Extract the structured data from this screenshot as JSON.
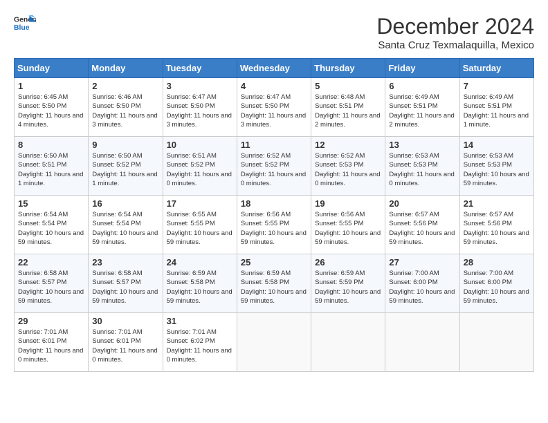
{
  "header": {
    "logo_line1": "General",
    "logo_line2": "Blue",
    "month": "December 2024",
    "location": "Santa Cruz Texmalaquilla, Mexico"
  },
  "days_of_week": [
    "Sunday",
    "Monday",
    "Tuesday",
    "Wednesday",
    "Thursday",
    "Friday",
    "Saturday"
  ],
  "weeks": [
    [
      {
        "day": 1,
        "sunrise": "6:45 AM",
        "sunset": "5:50 PM",
        "daylight": "11 hours and 4 minutes."
      },
      {
        "day": 2,
        "sunrise": "6:46 AM",
        "sunset": "5:50 PM",
        "daylight": "11 hours and 3 minutes."
      },
      {
        "day": 3,
        "sunrise": "6:47 AM",
        "sunset": "5:50 PM",
        "daylight": "11 hours and 3 minutes."
      },
      {
        "day": 4,
        "sunrise": "6:47 AM",
        "sunset": "5:50 PM",
        "daylight": "11 hours and 3 minutes."
      },
      {
        "day": 5,
        "sunrise": "6:48 AM",
        "sunset": "5:51 PM",
        "daylight": "11 hours and 2 minutes."
      },
      {
        "day": 6,
        "sunrise": "6:49 AM",
        "sunset": "5:51 PM",
        "daylight": "11 hours and 2 minutes."
      },
      {
        "day": 7,
        "sunrise": "6:49 AM",
        "sunset": "5:51 PM",
        "daylight": "11 hours and 1 minute."
      }
    ],
    [
      {
        "day": 8,
        "sunrise": "6:50 AM",
        "sunset": "5:51 PM",
        "daylight": "11 hours and 1 minute."
      },
      {
        "day": 9,
        "sunrise": "6:50 AM",
        "sunset": "5:52 PM",
        "daylight": "11 hours and 1 minute."
      },
      {
        "day": 10,
        "sunrise": "6:51 AM",
        "sunset": "5:52 PM",
        "daylight": "11 hours and 0 minutes."
      },
      {
        "day": 11,
        "sunrise": "6:52 AM",
        "sunset": "5:52 PM",
        "daylight": "11 hours and 0 minutes."
      },
      {
        "day": 12,
        "sunrise": "6:52 AM",
        "sunset": "5:53 PM",
        "daylight": "11 hours and 0 minutes."
      },
      {
        "day": 13,
        "sunrise": "6:53 AM",
        "sunset": "5:53 PM",
        "daylight": "11 hours and 0 minutes."
      },
      {
        "day": 14,
        "sunrise": "6:53 AM",
        "sunset": "5:53 PM",
        "daylight": "10 hours and 59 minutes."
      }
    ],
    [
      {
        "day": 15,
        "sunrise": "6:54 AM",
        "sunset": "5:54 PM",
        "daylight": "10 hours and 59 minutes."
      },
      {
        "day": 16,
        "sunrise": "6:54 AM",
        "sunset": "5:54 PM",
        "daylight": "10 hours and 59 minutes."
      },
      {
        "day": 17,
        "sunrise": "6:55 AM",
        "sunset": "5:55 PM",
        "daylight": "10 hours and 59 minutes."
      },
      {
        "day": 18,
        "sunrise": "6:56 AM",
        "sunset": "5:55 PM",
        "daylight": "10 hours and 59 minutes."
      },
      {
        "day": 19,
        "sunrise": "6:56 AM",
        "sunset": "5:55 PM",
        "daylight": "10 hours and 59 minutes."
      },
      {
        "day": 20,
        "sunrise": "6:57 AM",
        "sunset": "5:56 PM",
        "daylight": "10 hours and 59 minutes."
      },
      {
        "day": 21,
        "sunrise": "6:57 AM",
        "sunset": "5:56 PM",
        "daylight": "10 hours and 59 minutes."
      }
    ],
    [
      {
        "day": 22,
        "sunrise": "6:58 AM",
        "sunset": "5:57 PM",
        "daylight": "10 hours and 59 minutes."
      },
      {
        "day": 23,
        "sunrise": "6:58 AM",
        "sunset": "5:57 PM",
        "daylight": "10 hours and 59 minutes."
      },
      {
        "day": 24,
        "sunrise": "6:59 AM",
        "sunset": "5:58 PM",
        "daylight": "10 hours and 59 minutes."
      },
      {
        "day": 25,
        "sunrise": "6:59 AM",
        "sunset": "5:58 PM",
        "daylight": "10 hours and 59 minutes."
      },
      {
        "day": 26,
        "sunrise": "6:59 AM",
        "sunset": "5:59 PM",
        "daylight": "10 hours and 59 minutes."
      },
      {
        "day": 27,
        "sunrise": "7:00 AM",
        "sunset": "6:00 PM",
        "daylight": "10 hours and 59 minutes."
      },
      {
        "day": 28,
        "sunrise": "7:00 AM",
        "sunset": "6:00 PM",
        "daylight": "10 hours and 59 minutes."
      }
    ],
    [
      {
        "day": 29,
        "sunrise": "7:01 AM",
        "sunset": "6:01 PM",
        "daylight": "11 hours and 0 minutes."
      },
      {
        "day": 30,
        "sunrise": "7:01 AM",
        "sunset": "6:01 PM",
        "daylight": "11 hours and 0 minutes."
      },
      {
        "day": 31,
        "sunrise": "7:01 AM",
        "sunset": "6:02 PM",
        "daylight": "11 hours and 0 minutes."
      },
      null,
      null,
      null,
      null
    ]
  ]
}
